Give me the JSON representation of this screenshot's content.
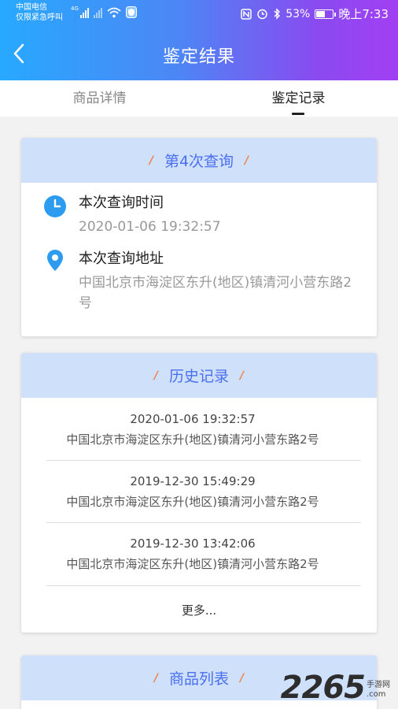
{
  "status_bar": {
    "carrier_line1": "中国电信",
    "carrier_line2": "仅限紧急呼叫",
    "network_type": "4G",
    "battery_percent": "53%",
    "time": "晚上7:33"
  },
  "header": {
    "title": "鉴定结果"
  },
  "tabs": [
    {
      "label": "商品详情",
      "active": false
    },
    {
      "label": "鉴定记录",
      "active": true
    }
  ],
  "query_card": {
    "title": "第4次查询",
    "time_label": "本次查询时间",
    "time_value": "2020-01-06 19:32:57",
    "address_label": "本次查询地址",
    "address_value": "中国北京市海淀区东升(地区)镇清河小营东路2号"
  },
  "history_card": {
    "title": "历史记录",
    "items": [
      {
        "time": "2020-01-06 19:32:57",
        "address": "中国北京市海淀区东升(地区)镇清河小营东路2号"
      },
      {
        "time": "2019-12-30 15:49:29",
        "address": "中国北京市海淀区东升(地区)镇清河小营东路2号"
      },
      {
        "time": "2019-12-30 13:42:06",
        "address": "中国北京市海淀区东升(地区)镇清河小营东路2号"
      }
    ],
    "more_label": "更多..."
  },
  "products_card": {
    "title": "商品列表"
  },
  "watermark": {
    "number": "2265",
    "side_top": "手游网",
    "side_bottom": ".com"
  },
  "colors": {
    "header_gradient_start": "#27a9ff",
    "header_gradient_end": "#a23ff2",
    "card_head_bg": "#cfe0fb",
    "card_title": "#4a6ff0",
    "accent_slash": "#f0824b",
    "icon_blue": "#2d9cf0"
  }
}
